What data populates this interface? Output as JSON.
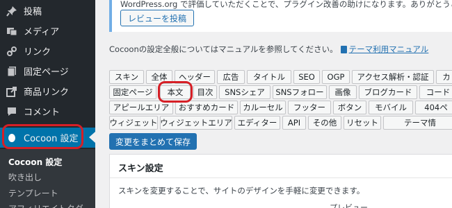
{
  "sidebar": {
    "items": [
      {
        "label": "投稿",
        "icon": "pin-icon"
      },
      {
        "label": "メディア",
        "icon": "media-icon"
      },
      {
        "label": "リンク",
        "icon": "link-icon"
      },
      {
        "label": "固定ページ",
        "icon": "pages-icon"
      },
      {
        "label": "商品リンク",
        "icon": "external-link-icon"
      },
      {
        "label": "コメント",
        "icon": "comment-icon"
      },
      {
        "label": "Cocoon 設定",
        "icon": "cocoon-icon"
      }
    ],
    "submenu": [
      "Cocoon 設定",
      "吹き出し",
      "テンプレート",
      "アフィリエイトタグ"
    ]
  },
  "notice": {
    "text": "WordPress.org で評価していただくことで、プラグイン改善の助けになります。ありがとうござい",
    "button": "レビューを投稿"
  },
  "info": {
    "text": "Cocoonの設定全般についてはマニュアルを参照してください。",
    "link": "テーマ利用マニュアル"
  },
  "tabs": {
    "row1": [
      "スキン",
      "全体",
      "ヘッダー",
      "広告",
      "タイトル",
      "SEO",
      "OGP",
      "アクセス解析・認証",
      "カ"
    ],
    "row2": [
      "固定ページ",
      "本文",
      "目次",
      "SNSシェア",
      "SNSフォロー",
      "画像",
      "ブログカード",
      "コード"
    ],
    "row3": [
      "アピールエリア",
      "おすすめカード",
      "カルーセル",
      "フッター",
      "ボタン",
      "モバイル",
      "404ペ"
    ],
    "row4": [
      "ウィジェット",
      "ウィジェットエリア",
      "エディター",
      "API",
      "その他",
      "リセット",
      "テーマ情"
    ]
  },
  "save_button": "変更をまとめて保存",
  "panel": {
    "title": "スキン設定",
    "description": "スキンを変更することで、サイトのデザインを手軽に変更できます。",
    "preview": "プレビュー"
  },
  "colors": {
    "sidebar_bg": "#23282d",
    "highlight_ring": "#d61f26",
    "primary_button": "#2271b1"
  }
}
